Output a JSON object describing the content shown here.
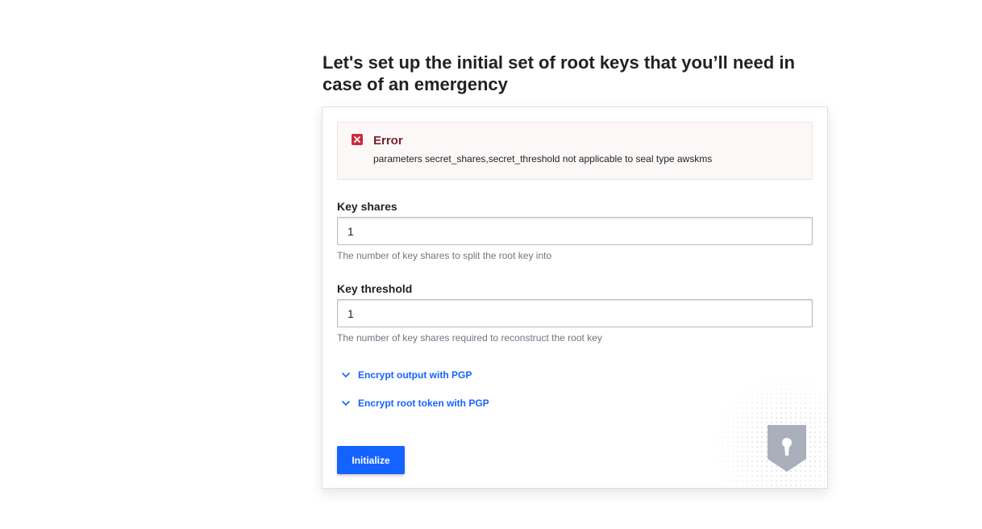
{
  "page": {
    "title": "Let's set up the initial set of root keys that you’ll need in case of an emergency"
  },
  "alert": {
    "icon": "error-x-icon",
    "title": "Error",
    "message": "parameters secret_shares,secret_threshold not applicable to seal type awskms",
    "color": "#ca2a3b"
  },
  "form": {
    "key_shares": {
      "label": "Key shares",
      "value": "1",
      "help": "The number of key shares to split the root key into"
    },
    "key_threshold": {
      "label": "Key threshold",
      "value": "1",
      "help": "The number of key shares required to reconstruct the root key"
    },
    "toggles": [
      {
        "label": "Encrypt output with PGP",
        "icon": "chevron-down-icon"
      },
      {
        "label": "Encrypt root token with PGP",
        "icon": "chevron-down-icon"
      }
    ],
    "submit_label": "Initialize"
  },
  "decoration": {
    "icon": "shield-keyhole-icon"
  },
  "colors": {
    "accent": "#1563ff",
    "error": "#ca2a3b",
    "text": "#1f2124",
    "muted": "#6f7682"
  }
}
